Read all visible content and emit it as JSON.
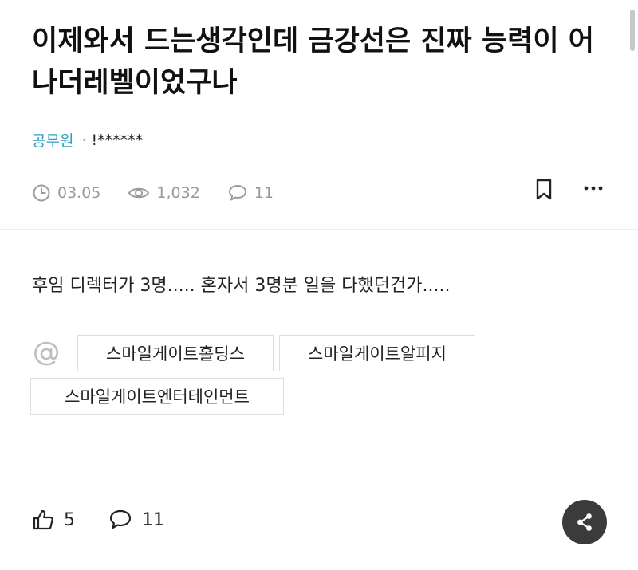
{
  "post": {
    "title": "이제와서 드는생각인데 금강선은 진짜 능력이 어나더레벨이었구나",
    "category": "공무원",
    "separator": "·",
    "author": "!******",
    "date": "03.05",
    "views": "1,032",
    "comments": "11",
    "body": "후임 디렉터가 3명..... 혼자서 3명분 일을 다했던건가....."
  },
  "tags": [
    "스마일게이트홀딩스",
    "스마일게이트알피지",
    "스마일게이트엔터테인먼트"
  ],
  "footer": {
    "likes": "5",
    "comments": "11"
  },
  "icons": {
    "date": "clock-icon",
    "views": "eye-icon",
    "comments": "speech-bubble-icon",
    "bookmark": "bookmark-icon",
    "more": "more-dots-icon",
    "mention": "at-sign-icon",
    "like": "thumbs-up-icon",
    "share": "share-icon"
  },
  "colors": {
    "category": "#2e9fc0",
    "share_button": "#3b3b3b",
    "muted": "#999999"
  }
}
